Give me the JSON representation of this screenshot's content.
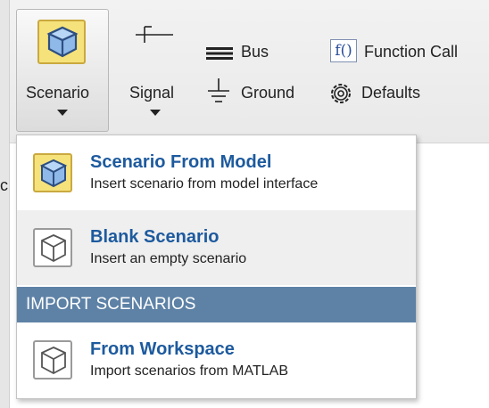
{
  "toolstrip": {
    "scenario_label": "Scenario",
    "signal_label": "Signal",
    "bus_label": "Bus",
    "ground_label": "Ground",
    "function_call_label": "Function Call",
    "function_call_glyph": "f()",
    "defaults_label": "Defaults",
    "scenario_icon": "cube-icon",
    "signal_icon": "signal-port-icon",
    "bus_icon": "bus-icon",
    "ground_icon": "ground-icon",
    "defaults_icon": "gear-icon"
  },
  "canvas": {
    "partial_text": "c"
  },
  "menu": {
    "items": [
      {
        "title": "Scenario From Model",
        "description": "Insert scenario from model interface",
        "icon": "cube-yellow-icon"
      },
      {
        "title": "Blank Scenario",
        "description": "Insert an empty scenario",
        "icon": "cube-icon"
      }
    ],
    "section_header": "IMPORT SCENARIOS",
    "import_items": [
      {
        "title": "From Workspace",
        "description": "Import scenarios from MATLAB",
        "icon": "cube-icon"
      }
    ]
  },
  "colors": {
    "menu_title": "#1d5a9e",
    "section_header_bg": "#5e82a6",
    "icon_yellow": "#f6e27a"
  }
}
